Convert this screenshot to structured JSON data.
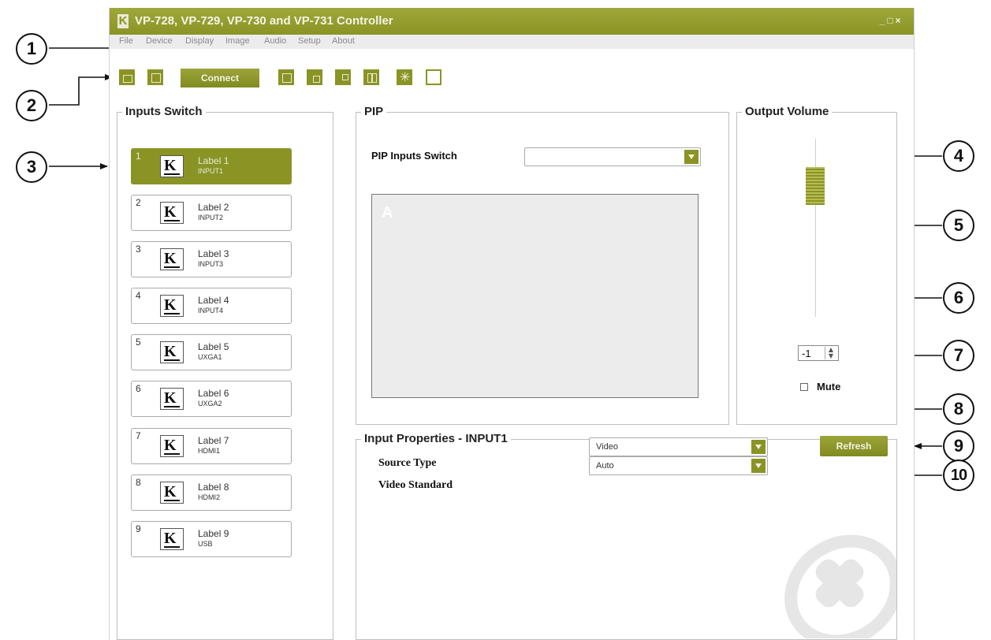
{
  "window": {
    "title": "VP-728, VP-729, VP-730 and VP-731 Controller",
    "controls": [
      "_",
      "□",
      "×"
    ]
  },
  "menu": [
    "File",
    "Device",
    "Display",
    "Image",
    "Audio",
    "Setup",
    "About"
  ],
  "toolbar": {
    "connect_label": "Connect",
    "icons": [
      "open-icon",
      "save-icon",
      "layout-full-icon",
      "layout-pip-icon",
      "layout-corner-icon",
      "layout-split-icon",
      "freeze-icon",
      "blank-icon"
    ]
  },
  "inputs_switch": {
    "title": "Inputs Switch",
    "items": [
      {
        "num": "1",
        "label": "Label 1",
        "input": "INPUT1"
      },
      {
        "num": "2",
        "label": "Label 2",
        "input": "INPUT2"
      },
      {
        "num": "3",
        "label": "Label 3",
        "input": "INPUT3"
      },
      {
        "num": "4",
        "label": "Label 4",
        "input": "INPUT4"
      },
      {
        "num": "5",
        "label": "Label 5",
        "input": "UXGA1"
      },
      {
        "num": "6",
        "label": "Label 6",
        "input": "UXGA2"
      },
      {
        "num": "7",
        "label": "Label 7",
        "input": "HDMI1"
      },
      {
        "num": "8",
        "label": "Label 8",
        "input": "HDMI2"
      },
      {
        "num": "9",
        "label": "Label 9",
        "input": "USB"
      }
    ],
    "selected": 1
  },
  "pip": {
    "title": "PIP",
    "switch_label": "PIP Inputs Switch",
    "switch_value": "",
    "preview_letter": "A"
  },
  "output_volume": {
    "title": "Output Volume",
    "value": "-1",
    "mute_label": "Mute",
    "muted": false
  },
  "input_properties": {
    "title": "Input Properties - INPUT1",
    "source_type_label": "Source Type",
    "source_type_value": "Video",
    "video_standard_label": "Video Standard",
    "video_standard_value": "Auto",
    "refresh_label": "Refresh"
  },
  "callouts": [
    "1",
    "2",
    "3",
    "4",
    "5",
    "6",
    "7",
    "8",
    "9",
    "10"
  ],
  "colors": {
    "accent": "#8a9425",
    "accent_text": "#f4f4e6"
  }
}
